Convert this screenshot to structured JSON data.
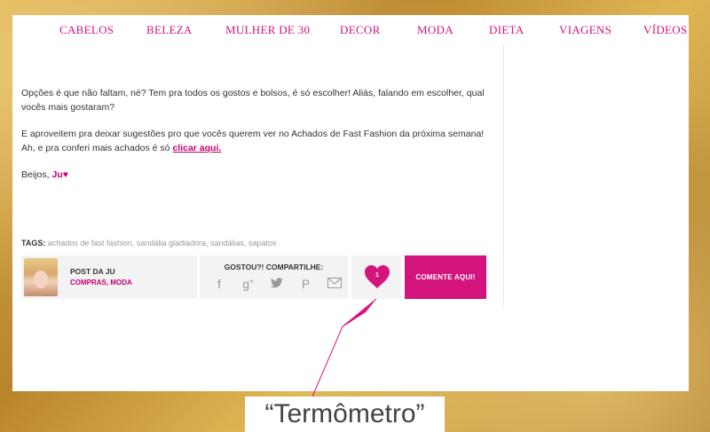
{
  "nav": {
    "items": [
      "CABELOS",
      "BELEZA",
      "MULHER DE 30",
      "DECOR",
      "MODA",
      "DIETA",
      "VIAGENS",
      "VÍDEOS"
    ]
  },
  "content": {
    "p1": "Opções é que não faltam, né? Tem pra todos os gostos e bolsos, é só escolher! Aliás, falando em escolher, qual vocês mais gostaram?",
    "p2_text": "E aproveitem pra deixar sugestões pro que vocês querem ver no Achados de Fast Fashion da próxima semana! Ah, e pra conferi mais achados é só ",
    "p2_link": "clicar aqui.",
    "p3_text": "Beijos, ",
    "signature": "Ju♥"
  },
  "tags": {
    "label": "TAGS:",
    "list": "achados de fast fashion, sandália gladiadora, sandálias, sapatos"
  },
  "author": {
    "title": "POST DA JU",
    "categories": "COMPRAS, MODA"
  },
  "share": {
    "label": "GOSTOU?! COMPARTILHE:",
    "icons": [
      "facebook-icon",
      "google-plus-icon",
      "twitter-icon",
      "pinterest-icon",
      "email-icon"
    ]
  },
  "like": {
    "count": "1"
  },
  "comment": {
    "label": "COMENTE AQUI!"
  },
  "caption": "“Termômetro”",
  "colors": {
    "accent": "#d4147d",
    "gold": "#c99a3a"
  }
}
